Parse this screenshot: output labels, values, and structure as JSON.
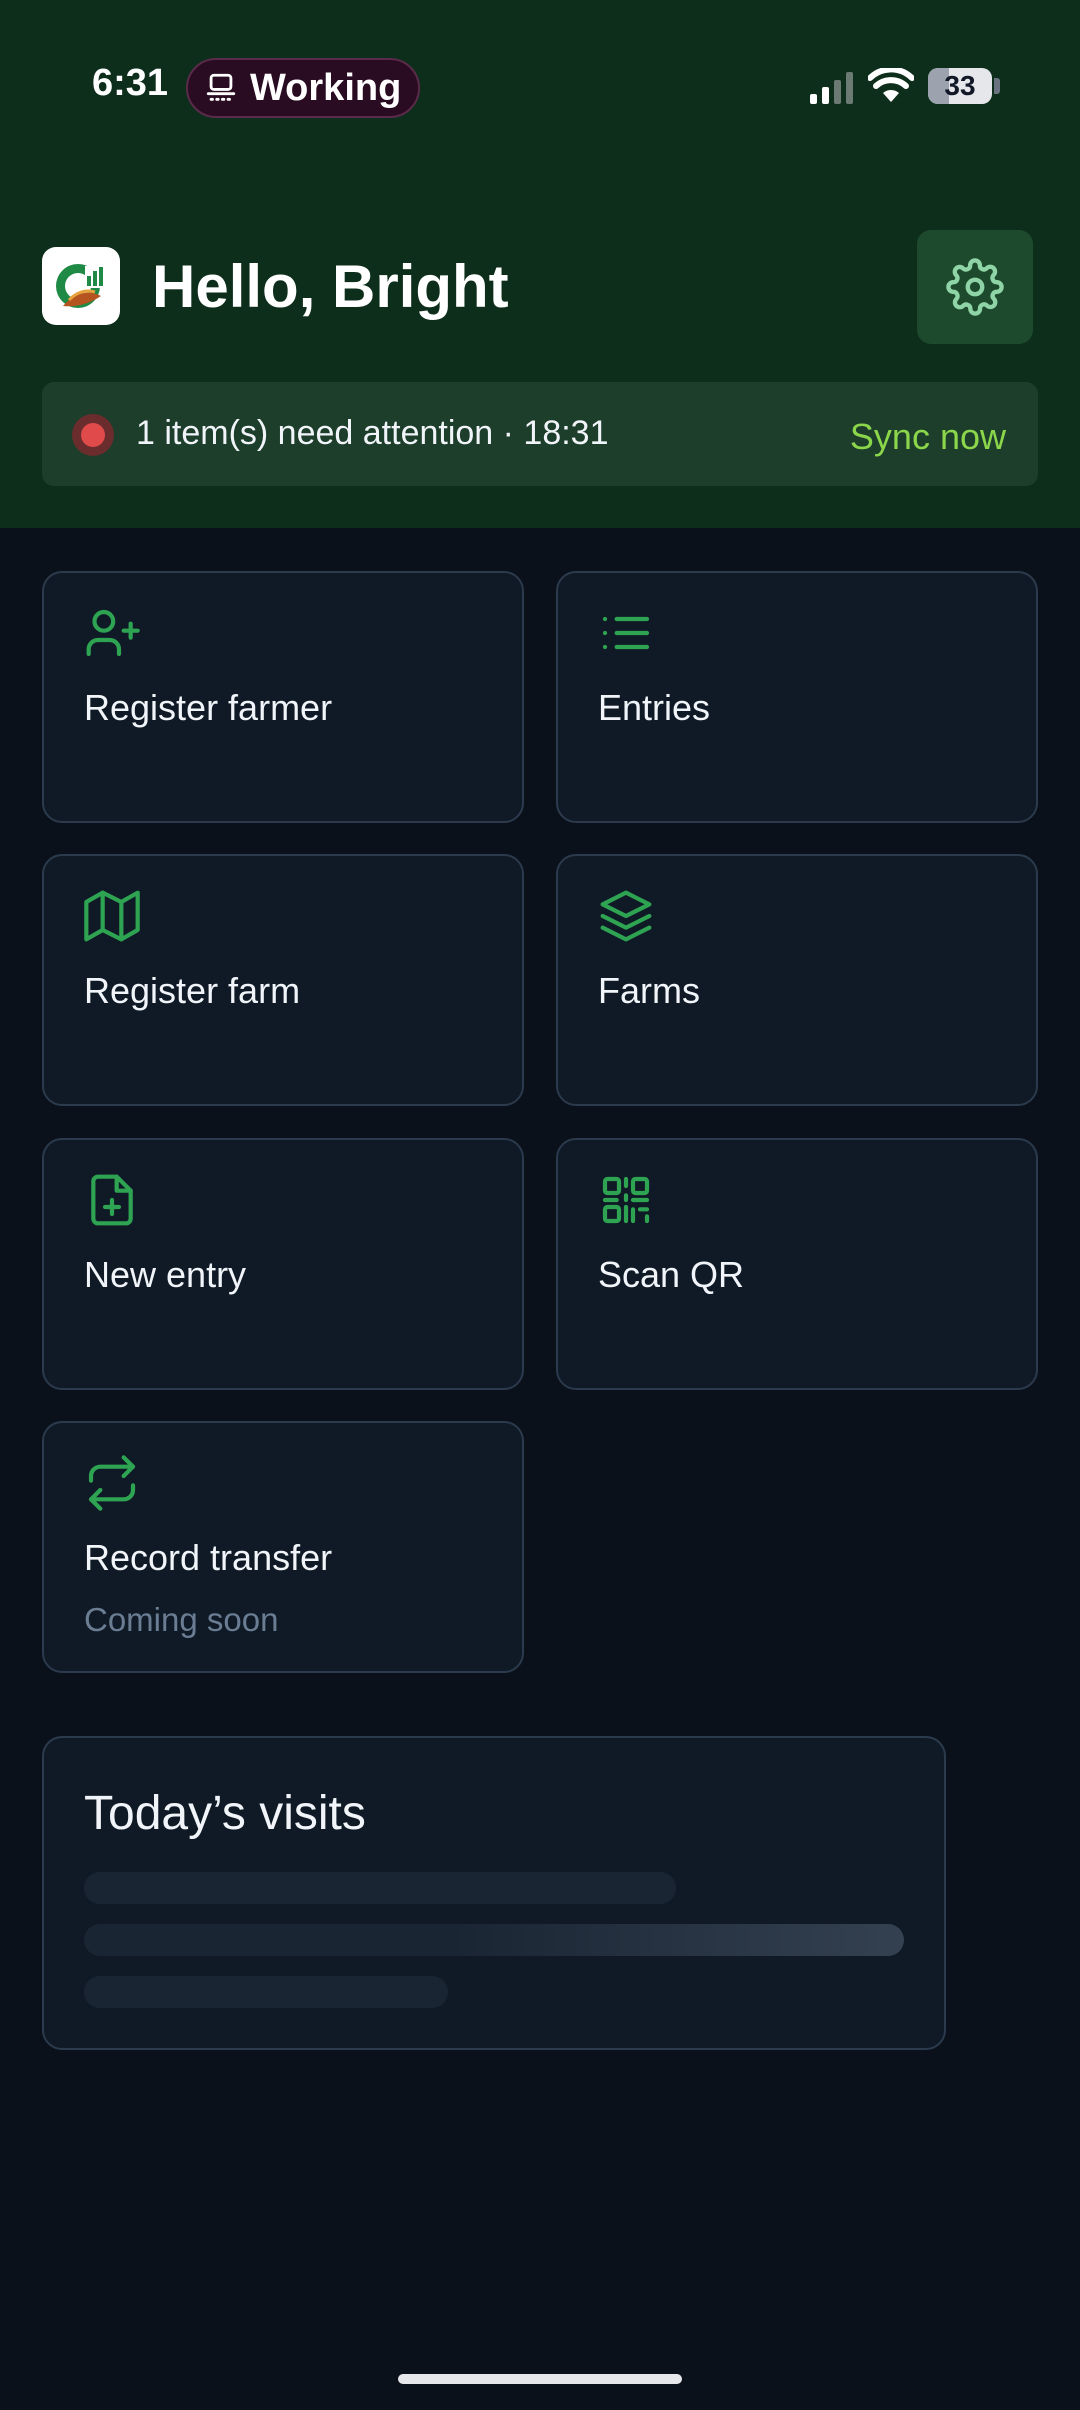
{
  "status_bar": {
    "time": "6:31",
    "activity_label": "Working",
    "battery_level": "33",
    "battery_fraction": 0.33
  },
  "header": {
    "greeting": "Hello, Bright",
    "attention_text": "1 item(s) need attention · 18:31",
    "sync_label": "Sync now"
  },
  "tiles": [
    {
      "label": "Register farmer",
      "icon": "user-plus-icon"
    },
    {
      "label": "Entries",
      "icon": "list-icon"
    },
    {
      "label": "Register farm",
      "icon": "map-icon"
    },
    {
      "label": "Farms",
      "icon": "layers-icon"
    },
    {
      "label": "New entry",
      "icon": "file-plus-icon"
    },
    {
      "label": "Scan QR",
      "icon": "qr-code-icon"
    },
    {
      "label": "Record transfer",
      "icon": "repeat-icon",
      "sublabel": "Coming soon"
    }
  ],
  "visits": {
    "title": "Today’s visits"
  },
  "colors": {
    "header_bg": "#0e2e1c",
    "accent_green": "#2ea452",
    "sync_green": "#8bd64a",
    "alert_red": "#e04a4a",
    "page_bg": "#0a111b"
  }
}
